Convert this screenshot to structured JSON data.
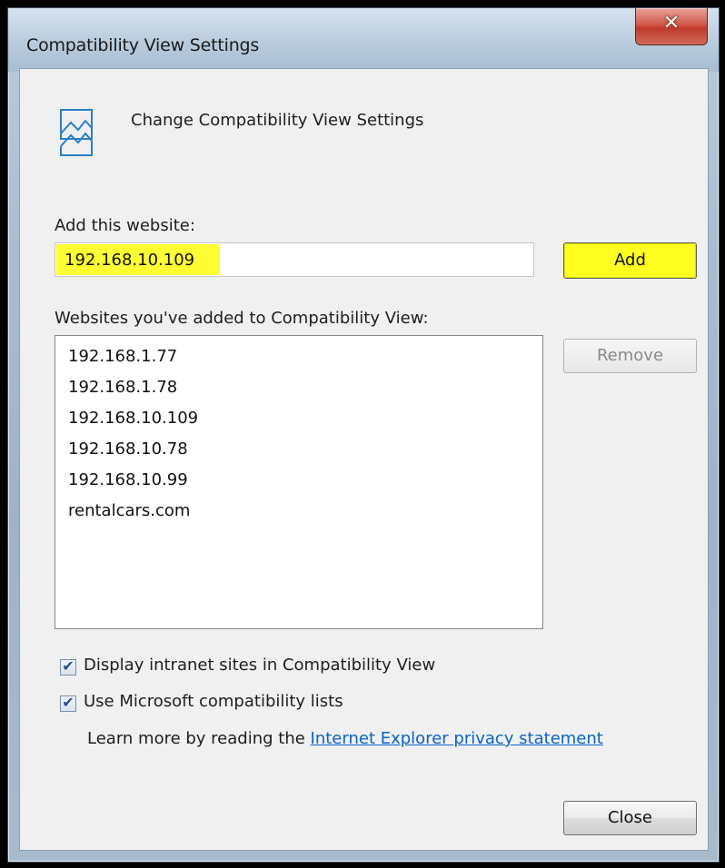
{
  "window": {
    "title": "Compatibility View Settings",
    "close_glyph": "✕"
  },
  "header": {
    "icon": "compatibility-view-icon",
    "text": "Change Compatibility View Settings"
  },
  "add_site": {
    "label": "Add this website:",
    "value": "192.168.10.109",
    "add_label": "Add",
    "highlight_color": "#ffff22"
  },
  "site_list": {
    "label": "Websites you've added to Compatibility View:",
    "items": [
      "192.168.1.77",
      "192.168.1.78",
      "192.168.10.109",
      "192.168.10.78",
      "192.168.10.99",
      "rentalcars.com"
    ],
    "remove_label": "Remove"
  },
  "options": {
    "intranet": {
      "label": "Display intranet sites in Compatibility View",
      "checked": true
    },
    "ms_lists": {
      "label": "Use Microsoft compatibility lists",
      "checked": true
    },
    "check_glyph": "✔"
  },
  "learn_more": {
    "prefix": "Learn more by reading the ",
    "link": "Internet Explorer privacy statement"
  },
  "footer": {
    "close_label": "Close"
  }
}
